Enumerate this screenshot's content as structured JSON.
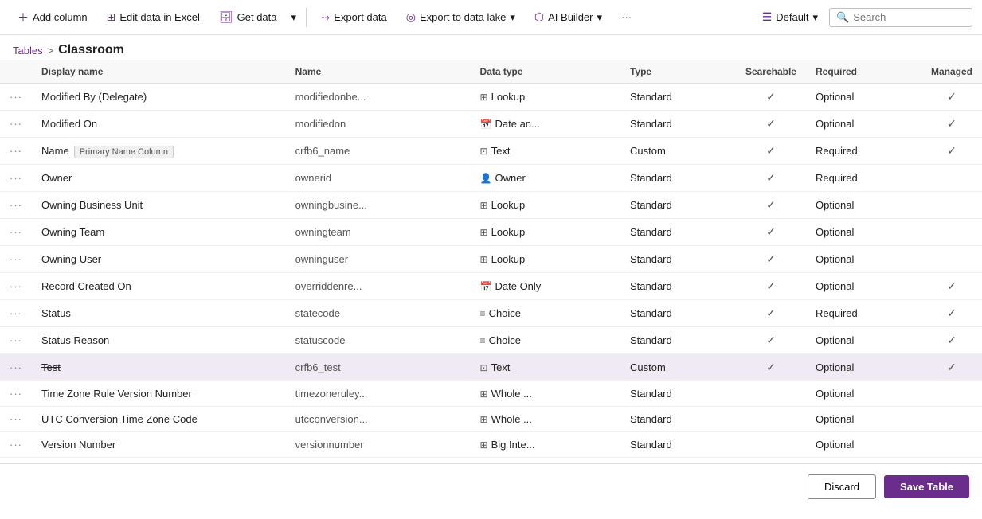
{
  "toolbar": {
    "add_column": "Add column",
    "edit_excel": "Edit data in Excel",
    "get_data": "Get data",
    "dropdown_arrow": "▾",
    "export_data": "Export data",
    "export_lake": "Export to data lake",
    "ai_builder": "AI Builder",
    "more": "···",
    "default_label": "Default",
    "search_placeholder": "Search"
  },
  "breadcrumb": {
    "tables": "Tables",
    "separator": ">",
    "current": "Classroom"
  },
  "table": {
    "columns": [
      "",
      "Display name",
      "Name",
      "Data type",
      "Type",
      "Searchable",
      "Required",
      "Managed"
    ],
    "rows": [
      {
        "displayName": "Modified By (Delegate)",
        "name": "modifiedonbe...",
        "typeIcon": "🔗",
        "dataType": "Lookup",
        "type": "Standard",
        "searchable": true,
        "required": "Optional",
        "managed": true,
        "selected": false
      },
      {
        "displayName": "Modified On",
        "name": "modifiedon",
        "typeIcon": "📅",
        "dataType": "Date an...",
        "type": "Standard",
        "searchable": true,
        "required": "Optional",
        "managed": true,
        "selected": false
      },
      {
        "displayName": "Name",
        "primaryBadge": "Primary Name Column",
        "name": "crfb6_name",
        "typeIcon": "🔤",
        "dataType": "Text",
        "type": "Custom",
        "searchable": true,
        "required": "Required",
        "managed": true,
        "selected": false
      },
      {
        "displayName": "Owner",
        "name": "ownerid",
        "typeIcon": "👤",
        "dataType": "Owner",
        "type": "Standard",
        "searchable": true,
        "required": "Required",
        "managed": false,
        "selected": false
      },
      {
        "displayName": "Owning Business Unit",
        "name": "owningbusine...",
        "typeIcon": "🔗",
        "dataType": "Lookup",
        "type": "Standard",
        "searchable": true,
        "required": "Optional",
        "managed": false,
        "selected": false
      },
      {
        "displayName": "Owning Team",
        "name": "owningteam",
        "typeIcon": "🔗",
        "dataType": "Lookup",
        "type": "Standard",
        "searchable": true,
        "required": "Optional",
        "managed": false,
        "selected": false
      },
      {
        "displayName": "Owning User",
        "name": "owninguser",
        "typeIcon": "🔗",
        "dataType": "Lookup",
        "type": "Standard",
        "searchable": true,
        "required": "Optional",
        "managed": false,
        "selected": false
      },
      {
        "displayName": "Record Created On",
        "name": "overriddenre...",
        "typeIcon": "📅",
        "dataType": "Date Only",
        "type": "Standard",
        "searchable": true,
        "required": "Optional",
        "managed": true,
        "selected": false
      },
      {
        "displayName": "Status",
        "name": "statecode",
        "typeIcon": "≡",
        "dataType": "Choice",
        "type": "Standard",
        "searchable": true,
        "required": "Required",
        "managed": true,
        "selected": false
      },
      {
        "displayName": "Status Reason",
        "name": "statuscode",
        "typeIcon": "≡",
        "dataType": "Choice",
        "type": "Standard",
        "searchable": true,
        "required": "Optional",
        "managed": true,
        "selected": false
      },
      {
        "displayName": "Test",
        "strikethrough": true,
        "name": "crfb6_test",
        "typeIcon": "🔤",
        "dataType": "Text",
        "type": "Custom",
        "searchable": true,
        "required": "Optional",
        "managed": true,
        "selected": true
      },
      {
        "displayName": "Time Zone Rule Version Number",
        "name": "timezoneruley...",
        "typeIcon": "🔢",
        "dataType": "Whole ...",
        "type": "Standard",
        "searchable": false,
        "required": "Optional",
        "managed": false,
        "selected": false
      },
      {
        "displayName": "UTC Conversion Time Zone Code",
        "name": "utcconversion...",
        "typeIcon": "🔢",
        "dataType": "Whole ...",
        "type": "Standard",
        "searchable": false,
        "required": "Optional",
        "managed": false,
        "selected": false
      },
      {
        "displayName": "Version Number",
        "name": "versionnumber",
        "typeIcon": "🔢",
        "dataType": "Big Inte...",
        "type": "Standard",
        "searchable": false,
        "required": "Optional",
        "managed": false,
        "selected": false
      }
    ]
  },
  "footer": {
    "discard": "Discard",
    "save": "Save Table"
  }
}
